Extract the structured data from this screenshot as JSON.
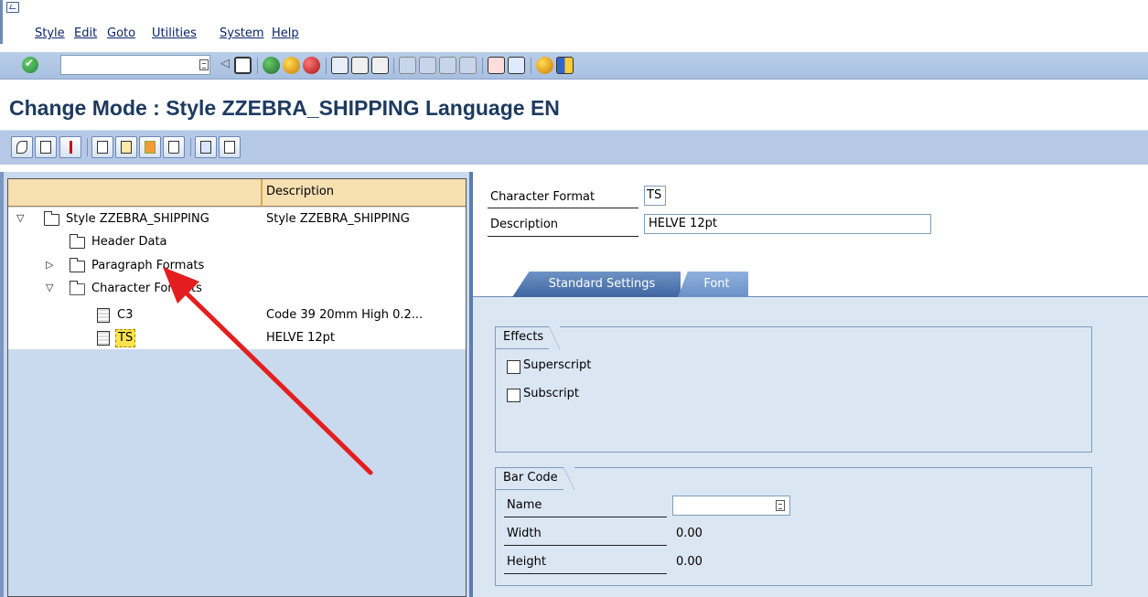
{
  "menu": {
    "items": [
      "Style",
      "Edit",
      "Goto",
      "Utilities",
      "System",
      "Help"
    ]
  },
  "toolbar": {
    "command_field_value": ""
  },
  "title": "Change Mode : Style ZZEBRA_SHIPPING Language EN",
  "tree": {
    "header_col2": "Description",
    "nodes": [
      {
        "label": "Style ZZEBRA_SHIPPING",
        "description": "Style ZZEBRA_SHIPPING"
      },
      {
        "label": "Header Data",
        "description": ""
      },
      {
        "label": "Paragraph Formats",
        "description": ""
      },
      {
        "label": "Character Formats",
        "description": ""
      },
      {
        "label": "C3",
        "description": "Code 39 20mm High 0.2..."
      },
      {
        "label": "TS",
        "description": "HELVE 12pt"
      }
    ]
  },
  "detail": {
    "char_format_label": "Character Format",
    "char_format_value": "TS",
    "description_label": "Description",
    "description_value": "HELVE 12pt",
    "tabs": [
      "Standard Settings",
      "Font"
    ],
    "effects": {
      "title": "Effects",
      "superscript": "Superscript",
      "subscript": "Subscript"
    },
    "barcode": {
      "title": "Bar Code",
      "name_label": "Name",
      "name_value": "",
      "width_label": "Width",
      "width_value": "0.00",
      "height_label": "Height",
      "height_value": "0.00"
    }
  },
  "colors": {
    "title": "#1e3a60",
    "tab_active": "#3e66a0",
    "highlight": "#fbe44f",
    "arrow": "#e41e1e"
  }
}
